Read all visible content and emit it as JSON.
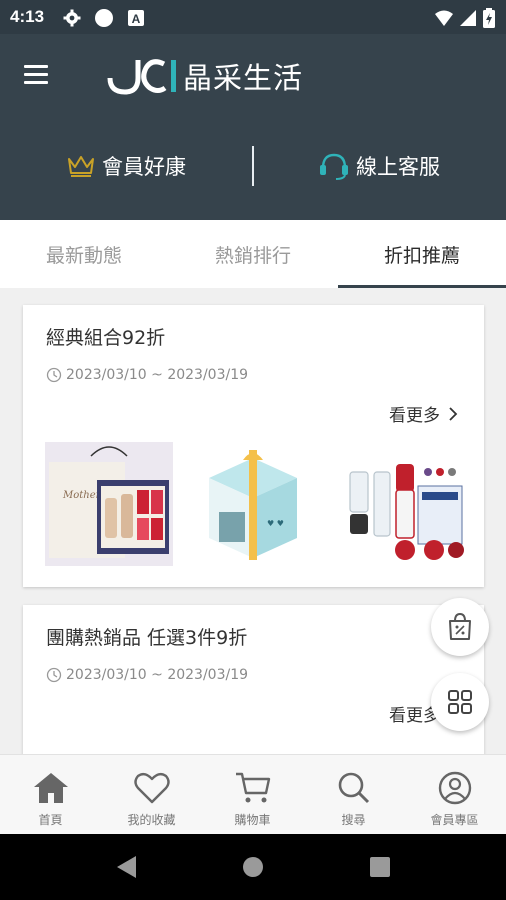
{
  "status_bar": {
    "time": "4:13",
    "icons": [
      "gear-icon",
      "circle-icon",
      "a-icon",
      "wifi-icon",
      "signal-icon",
      "battery-icon"
    ]
  },
  "header": {
    "brand": "晶采生活",
    "member_deals": "會員好康",
    "online_service": "線上客服",
    "colors": {
      "header_bg": "#36434c",
      "accent": "#c9a227",
      "teal": "#2fb3b9"
    }
  },
  "tabs": [
    {
      "label": "最新動態"
    },
    {
      "label": "熱銷排行"
    },
    {
      "label": "折扣推薦"
    }
  ],
  "active_tab": "折扣推薦",
  "cards": [
    {
      "title": "經典組合92折",
      "date": "2023/03/10 ~ 2023/03/19",
      "see_more": "看更多"
    },
    {
      "title": "團購熱銷品 任選3件9折",
      "date": "2023/03/10 ~ 2023/03/19",
      "see_more": "看更多"
    }
  ],
  "bottom_nav": [
    {
      "label": "首頁",
      "icon": "home-icon"
    },
    {
      "label": "我的收藏",
      "icon": "heart-icon"
    },
    {
      "label": "購物車",
      "icon": "cart-icon"
    },
    {
      "label": "搜尋",
      "icon": "search-icon"
    },
    {
      "label": "會員專區",
      "icon": "user-icon"
    }
  ]
}
